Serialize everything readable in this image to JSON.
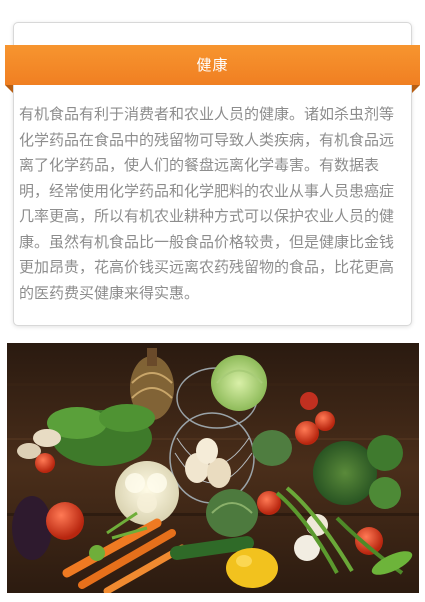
{
  "header": {
    "title": "健康"
  },
  "content": {
    "paragraph": "有机食品有利于消费者和农业人员的健康。诸如杀虫剂等化学药品在食品中的残留物可导致人类疾病，有机食品远离了化学药品，使人们的餐盘远离化学毒害。有数据表明，经常使用化学药品和化学肥料的农业从事人员患癌症几率更高，所以有机农业耕种方式可以保护农业人员的健康。虽然有机食品比一般食品价格较贵，但是健康比金钱更加昂贵，花高价钱买远离农药残留物的食品，比花更高的医药费买健康来得实惠。"
  },
  "colors": {
    "accent": "#f5892a",
    "text": "#8d8d8d"
  },
  "image": {
    "subject": "vegetables-photo"
  }
}
